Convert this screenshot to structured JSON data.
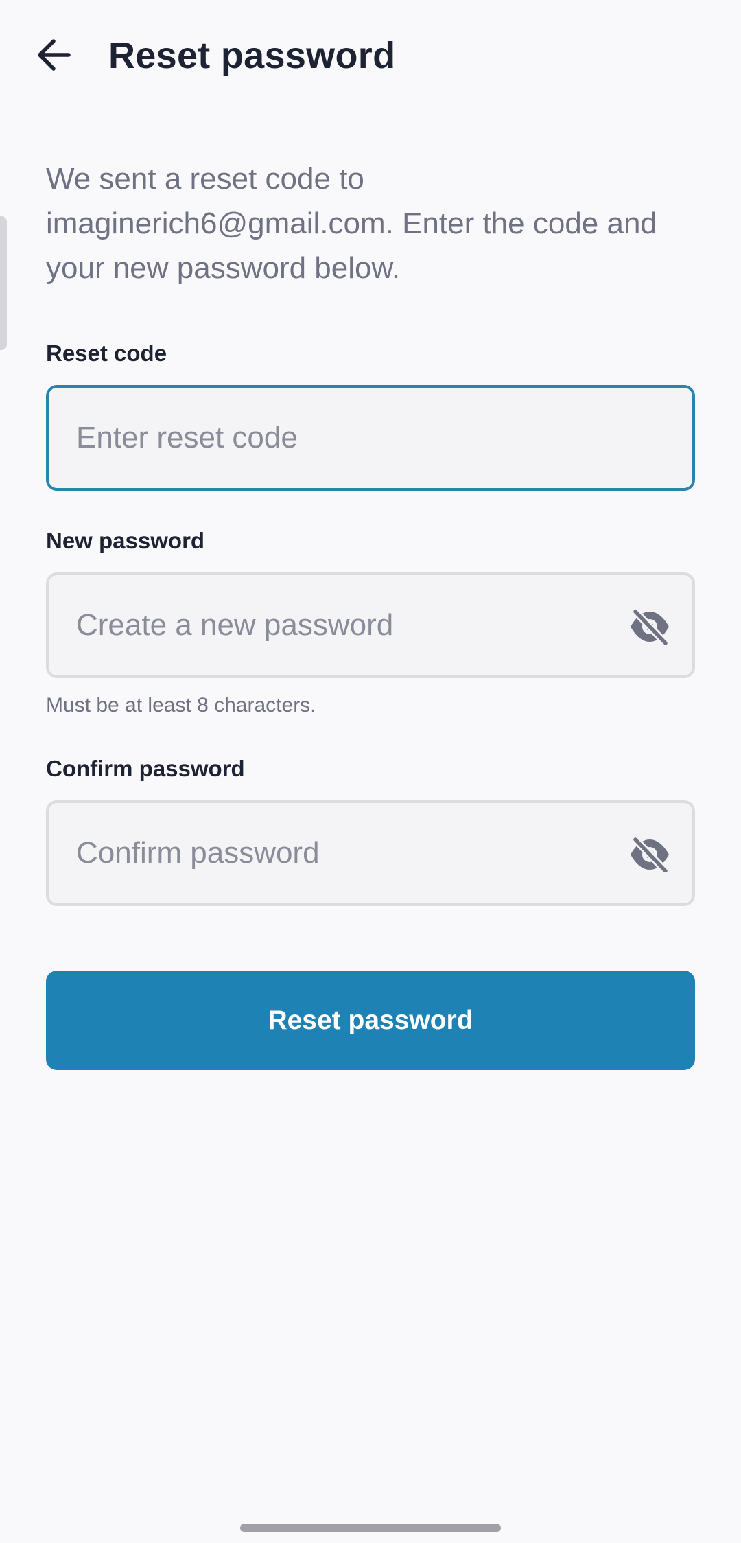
{
  "header": {
    "back_icon": "arrow-left-icon",
    "title": "Reset password"
  },
  "intro_text": "We sent a reset code to imaginerich6@gmail.com. Enter the code and your new password below.",
  "form": {
    "reset_code": {
      "label": "Reset code",
      "placeholder": "Enter reset code",
      "value": "",
      "focused": true
    },
    "new_password": {
      "label": "New password",
      "placeholder": "Create a new password",
      "value": "",
      "helper": "Must be at least 8 characters.",
      "toggle_icon": "eye-off-icon"
    },
    "confirm_password": {
      "label": "Confirm password",
      "placeholder": "Confirm password",
      "value": "",
      "toggle_icon": "eye-off-icon"
    },
    "submit_label": "Reset password"
  },
  "colors": {
    "background": "#f9f9fc",
    "primary": "#1e82b4",
    "focus_border": "#2b84ad",
    "text_primary": "#1e2333",
    "text_secondary": "#6e7282"
  }
}
